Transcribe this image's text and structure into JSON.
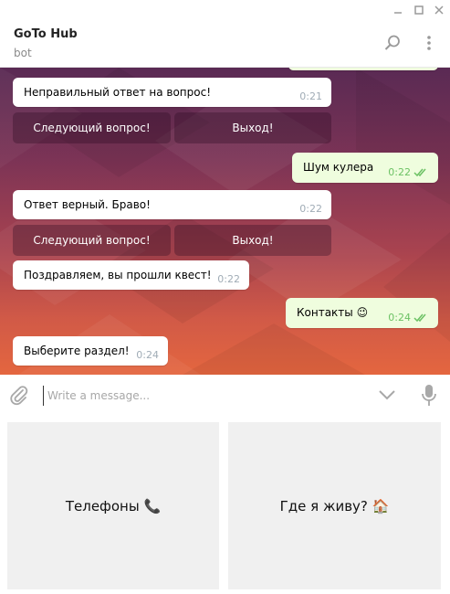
{
  "chat": {
    "title": "GoTo Hub",
    "subtitle": "bot"
  },
  "messages": [
    {
      "text": "Неправильный ответ на вопрос!",
      "time": "0:21",
      "dir": "in"
    },
    {
      "text": "Шум кулера",
      "time": "0:22",
      "dir": "out"
    },
    {
      "text": "Ответ верный. Браво!",
      "time": "0:22",
      "dir": "in"
    },
    {
      "text": "Поздравляем, вы прошли квест!",
      "time": "0:22",
      "dir": "in"
    },
    {
      "text": "Контакты 😉",
      "time": "0:24",
      "dir": "out"
    },
    {
      "text": "Выберите раздел!",
      "time": "0:24",
      "dir": "in"
    }
  ],
  "inline_buttons": {
    "next_label": "Следующий вопрос!",
    "exit_label": "Выход!"
  },
  "composer": {
    "placeholder": "Write a message..."
  },
  "reply_keyboard": [
    {
      "label": "Телефоны 📞"
    },
    {
      "label": "Где я живу? 🏠"
    }
  ],
  "icons": {
    "minimize": "minimize-icon",
    "maximize": "maximize-icon",
    "close": "close-icon",
    "search": "search-icon",
    "more": "more-vertical-icon",
    "attach": "paperclip-icon",
    "keyboard_toggle": "chevron-down-icon",
    "mic": "microphone-icon",
    "read": "double-check-icon"
  },
  "colors": {
    "outgoing_bubble": "#effdde",
    "incoming_bubble": "#ffffff",
    "check_color": "#6cc264",
    "reply_button_bg": "#f0f0f0"
  }
}
